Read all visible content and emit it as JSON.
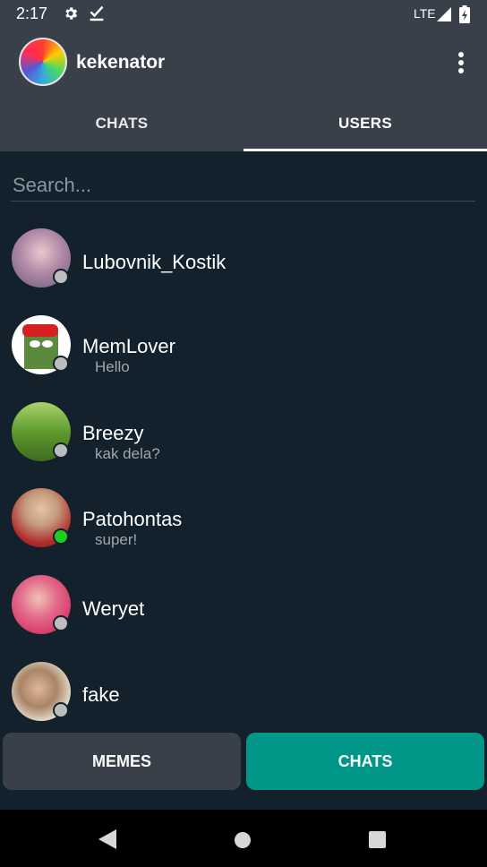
{
  "status_bar": {
    "time": "2:17",
    "network": "LTE"
  },
  "header": {
    "username": "kekenator"
  },
  "tabs": [
    {
      "label": "CHATS",
      "active": false
    },
    {
      "label": "USERS",
      "active": true
    }
  ],
  "search": {
    "placeholder": "Search..."
  },
  "users": [
    {
      "name": "Lubovnik_Kostik",
      "last_message": "",
      "online": false
    },
    {
      "name": "MemLover",
      "last_message": "Hello",
      "online": false
    },
    {
      "name": "Breezy",
      "last_message": "kak dela?",
      "online": false
    },
    {
      "name": "Patohontas",
      "last_message": "super!",
      "online": true
    },
    {
      "name": "Weryet",
      "last_message": "",
      "online": false
    },
    {
      "name": "fake",
      "last_message": "",
      "online": false
    }
  ],
  "bottom_buttons": {
    "memes_label": "MEMES",
    "chats_label": "CHATS"
  },
  "colors": {
    "background": "#12212b",
    "app_bar": "#3a404a",
    "accent": "#009688",
    "online": "#22cc22",
    "offline": "#bdbdbd"
  }
}
